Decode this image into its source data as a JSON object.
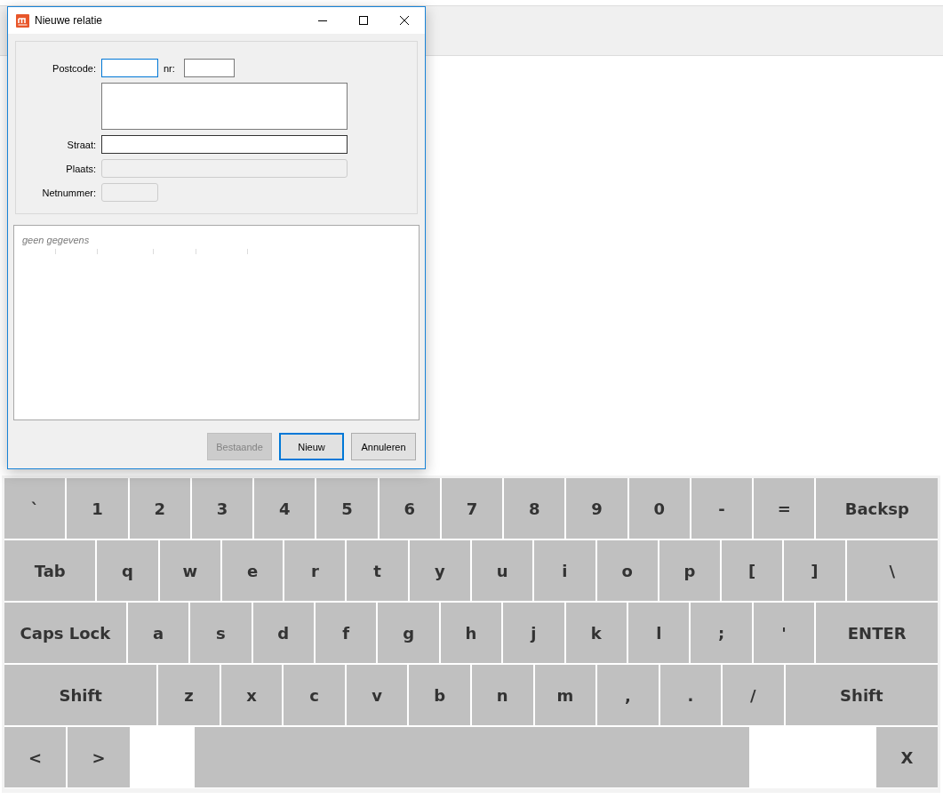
{
  "window": {
    "title": "Nieuwe relatie"
  },
  "form": {
    "rows": [
      {
        "kind": "pair",
        "label": "Postcode:",
        "focused": true,
        "hovered": false,
        "disabled": false,
        "second_label": "nr:"
      },
      {
        "kind": "area",
        "focused": false,
        "hovered": false,
        "disabled": false
      },
      {
        "kind": "line",
        "label": "Straat:",
        "focused": false,
        "hovered": true,
        "disabled": false
      },
      {
        "kind": "line",
        "label": "Plaats:",
        "focused": false,
        "hovered": false,
        "disabled": true
      },
      {
        "kind": "short",
        "label": "Netnummer:",
        "focused": false,
        "hovered": false,
        "disabled": true
      }
    ]
  },
  "results": {
    "empty_text": "geen gegevens"
  },
  "buttons": [
    {
      "label": "Bestaande",
      "disabled": true,
      "default": false
    },
    {
      "label": "Nieuw",
      "disabled": false,
      "default": true
    },
    {
      "label": "Annuleren",
      "disabled": false,
      "default": false
    }
  ],
  "keyboard": {
    "rows": [
      {
        "keys": [
          {
            "label": "`",
            "kind": "normal"
          },
          {
            "label": "1",
            "kind": "normal"
          },
          {
            "label": "2",
            "kind": "normal"
          },
          {
            "label": "3",
            "kind": "normal"
          },
          {
            "label": "4",
            "kind": "normal"
          },
          {
            "label": "5",
            "kind": "normal"
          },
          {
            "label": "6",
            "kind": "normal"
          },
          {
            "label": "7",
            "kind": "normal"
          },
          {
            "label": "8",
            "kind": "normal"
          },
          {
            "label": "9",
            "kind": "normal"
          },
          {
            "label": "0",
            "kind": "normal"
          },
          {
            "label": "-",
            "kind": "normal"
          },
          {
            "label": "=",
            "kind": "normal"
          },
          {
            "label": "Backsp",
            "kind": "wide"
          }
        ]
      },
      {
        "keys": [
          {
            "label": "Tab",
            "kind": "medium"
          },
          {
            "label": "q",
            "kind": "normal"
          },
          {
            "label": "w",
            "kind": "normal"
          },
          {
            "label": "e",
            "kind": "normal"
          },
          {
            "label": "r",
            "kind": "normal"
          },
          {
            "label": "t",
            "kind": "normal"
          },
          {
            "label": "y",
            "kind": "normal"
          },
          {
            "label": "u",
            "kind": "normal"
          },
          {
            "label": "i",
            "kind": "normal"
          },
          {
            "label": "o",
            "kind": "normal"
          },
          {
            "label": "p",
            "kind": "normal"
          },
          {
            "label": "[",
            "kind": "normal"
          },
          {
            "label": "]",
            "kind": "normal"
          },
          {
            "label": "\\",
            "kind": "medium"
          }
        ]
      },
      {
        "keys": [
          {
            "label": "Caps Lock",
            "kind": "wide"
          },
          {
            "label": "a",
            "kind": "normal"
          },
          {
            "label": "s",
            "kind": "normal"
          },
          {
            "label": "d",
            "kind": "normal"
          },
          {
            "label": "f",
            "kind": "normal"
          },
          {
            "label": "g",
            "kind": "normal"
          },
          {
            "label": "h",
            "kind": "normal"
          },
          {
            "label": "j",
            "kind": "normal"
          },
          {
            "label": "k",
            "kind": "normal"
          },
          {
            "label": "l",
            "kind": "normal"
          },
          {
            "label": ";",
            "kind": "normal"
          },
          {
            "label": "'",
            "kind": "normal"
          },
          {
            "label": "ENTER",
            "kind": "wide"
          }
        ]
      },
      {
        "keys": [
          {
            "label": "Shift",
            "kind": "shift"
          },
          {
            "label": "z",
            "kind": "normal"
          },
          {
            "label": "x",
            "kind": "normal"
          },
          {
            "label": "c",
            "kind": "normal"
          },
          {
            "label": "v",
            "kind": "normal"
          },
          {
            "label": "b",
            "kind": "normal"
          },
          {
            "label": "n",
            "kind": "normal"
          },
          {
            "label": "m",
            "kind": "normal"
          },
          {
            "label": ",",
            "kind": "normal"
          },
          {
            "label": ".",
            "kind": "normal"
          },
          {
            "label": "/",
            "kind": "normal"
          },
          {
            "label": "Shift",
            "kind": "shift"
          }
        ]
      },
      {
        "keys": [
          {
            "label": "<",
            "kind": "normal"
          },
          {
            "label": ">",
            "kind": "normal"
          },
          {
            "kind": "space"
          },
          {
            "label": "X",
            "kind": "end"
          }
        ]
      }
    ]
  }
}
